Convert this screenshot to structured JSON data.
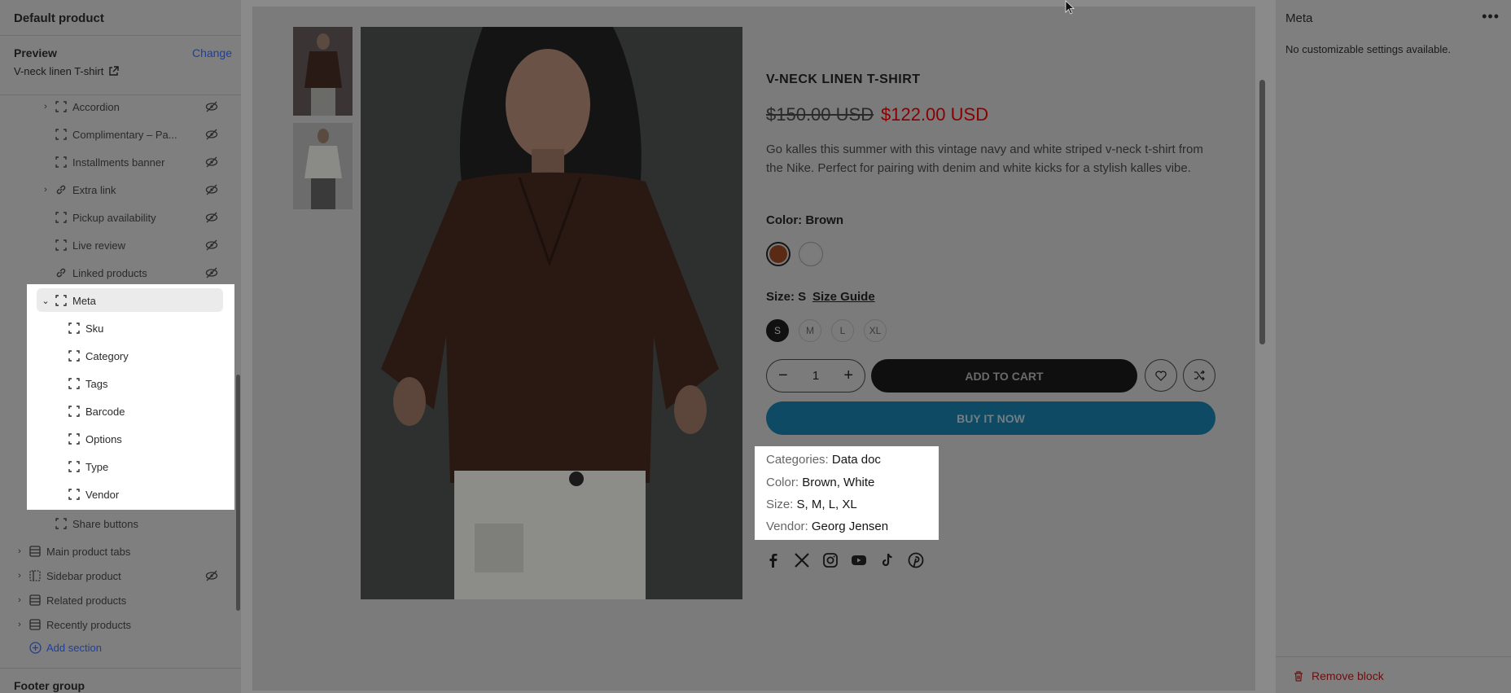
{
  "sidebar": {
    "title": "Default product",
    "preview_label": "Preview",
    "change_label": "Change",
    "product_name": "V-neck linen T-shirt",
    "blocks": [
      {
        "label": "Accordion",
        "icon": "block-icon",
        "chevron": true,
        "hidden": true
      },
      {
        "label": "Complimentary – Pa...",
        "icon": "block-icon",
        "chevron": false,
        "hidden": true
      },
      {
        "label": "Installments banner",
        "icon": "block-icon",
        "chevron": false,
        "hidden": true
      },
      {
        "label": "Extra link",
        "icon": "link-icon",
        "chevron": true,
        "hidden": true
      },
      {
        "label": "Pickup availability",
        "icon": "block-icon",
        "chevron": false,
        "hidden": true
      },
      {
        "label": "Live review",
        "icon": "block-icon",
        "chevron": false,
        "hidden": true
      },
      {
        "label": "Linked products",
        "icon": "link-icon",
        "chevron": false,
        "hidden": true
      }
    ],
    "meta": {
      "label": "Meta",
      "children": [
        "Sku",
        "Category",
        "Tags",
        "Barcode",
        "Options",
        "Type",
        "Vendor"
      ]
    },
    "share_buttons": "Share buttons",
    "sections": [
      {
        "label": "Main product tabs",
        "hidden": false
      },
      {
        "label": "Sidebar product",
        "hidden": true
      },
      {
        "label": "Related products",
        "hidden": false
      },
      {
        "label": "Recently products",
        "hidden": false
      }
    ],
    "add_section": "Add section",
    "footer_group": "Footer group"
  },
  "product": {
    "title": "V-NECK LINEN T-SHIRT",
    "old_price": "$150.00 USD",
    "new_price": "$122.00 USD",
    "description": "Go kalles this summer with this vintage navy and white striped v-neck t-shirt from the Nike. Perfect for pairing with denim and white kicks for a stylish kalles vibe.",
    "color_label": "Color: Brown",
    "swatches": [
      "#5a2a15",
      "#cfcfcf"
    ],
    "size_label": "Size: S",
    "size_guide": "Size Guide",
    "sizes": [
      "S",
      "M",
      "L",
      "XL"
    ],
    "selected_size": "S",
    "quantity": "1",
    "add_to_cart": "ADD TO CART",
    "buy_now": "BUY IT NOW",
    "meta": [
      {
        "key": "Categories:",
        "value": "Data doc"
      },
      {
        "key": "Color:",
        "value": "Brown, White"
      },
      {
        "key": "Size:",
        "value": "S, M, L, XL"
      },
      {
        "key": "Vendor:",
        "value": "Georg Jensen"
      }
    ],
    "social": [
      "facebook-icon",
      "x-icon",
      "instagram-icon",
      "youtube-icon",
      "tiktok-icon",
      "pinterest-icon"
    ]
  },
  "right_panel": {
    "title": "Meta",
    "message": "No customizable settings available.",
    "remove_block": "Remove block"
  }
}
